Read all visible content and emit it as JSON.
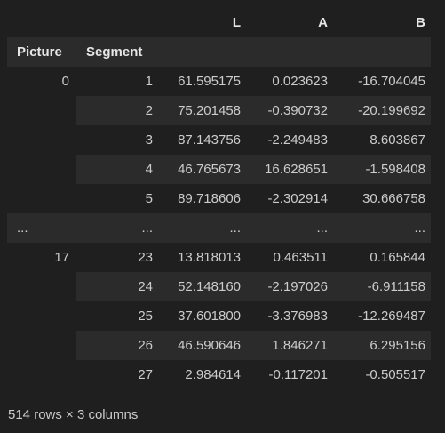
{
  "header": {
    "columns": [
      "",
      "",
      "L",
      "A",
      "B"
    ],
    "index_names": [
      "Picture",
      "Segment"
    ]
  },
  "rows": [
    {
      "picture": "0",
      "segment": "1",
      "L": "61.595175",
      "A": "0.023623",
      "B": "-16.704045"
    },
    {
      "picture": "",
      "segment": "2",
      "L": "75.201458",
      "A": "-0.390732",
      "B": "-20.199692"
    },
    {
      "picture": "",
      "segment": "3",
      "L": "87.143756",
      "A": "-2.249483",
      "B": "8.603867"
    },
    {
      "picture": "",
      "segment": "4",
      "L": "46.765673",
      "A": "16.628651",
      "B": "-1.598408"
    },
    {
      "picture": "",
      "segment": "5",
      "L": "89.718606",
      "A": "-2.302914",
      "B": "30.666758"
    },
    {
      "picture": "...",
      "segment": "...",
      "L": "...",
      "A": "...",
      "B": "..."
    },
    {
      "picture": "17",
      "segment": "23",
      "L": "13.818013",
      "A": "0.463511",
      "B": "0.165844"
    },
    {
      "picture": "",
      "segment": "24",
      "L": "52.148160",
      "A": "-2.197026",
      "B": "-6.911158"
    },
    {
      "picture": "",
      "segment": "25",
      "L": "37.601800",
      "A": "-3.376983",
      "B": "-12.269487"
    },
    {
      "picture": "",
      "segment": "26",
      "L": "46.590646",
      "A": "1.846271",
      "B": "6.295156"
    },
    {
      "picture": "",
      "segment": "27",
      "L": "2.984614",
      "A": "-0.117201",
      "B": "-0.505517"
    }
  ],
  "footer": "514 rows × 3 columns"
}
